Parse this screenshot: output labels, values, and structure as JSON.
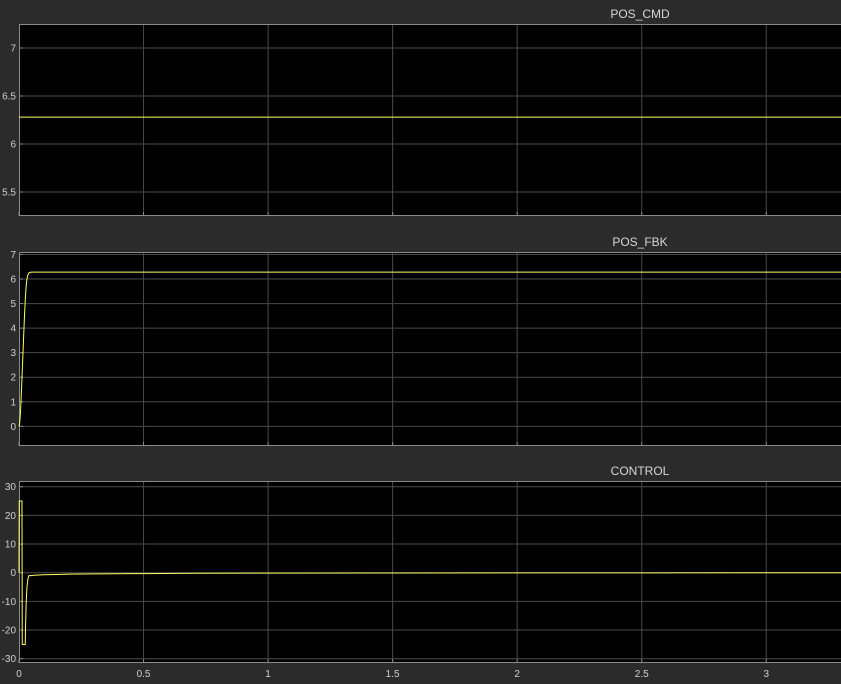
{
  "colors": {
    "figure_bg": "#2b2b2b",
    "axes_bg": "#000000",
    "grid": "#4a4a4a",
    "axes_edge": "#8a8a8a",
    "tick_text": "#cfcfcf",
    "title_text": "#d6d6d6",
    "signal": "#ffff66"
  },
  "chart_data": [
    {
      "type": "line",
      "title": "POS_CMD",
      "xlabel": "",
      "ylabel": "",
      "xlim": [
        0,
        3.3
      ],
      "ylim": [
        5.25,
        7.25
      ],
      "grid": true,
      "x_ticks": [
        0,
        0.5,
        1,
        1.5,
        2,
        2.5,
        3
      ],
      "x_tick_labels": [
        "",
        "",
        "",
        "",
        "",
        "",
        ""
      ],
      "y_ticks": [
        5.5,
        6,
        6.5,
        7
      ],
      "y_tick_labels": [
        "5.5",
        "6",
        "6.5",
        "7"
      ],
      "series": [
        {
          "x": [
            0,
            3.3
          ],
          "y": [
            6.28,
            6.28
          ]
        }
      ]
    },
    {
      "type": "line",
      "title": "POS_FBK",
      "xlabel": "",
      "ylabel": "",
      "xlim": [
        0,
        3.3
      ],
      "ylim": [
        -0.8,
        7.1
      ],
      "grid": true,
      "x_ticks": [
        0,
        0.5,
        1,
        1.5,
        2,
        2.5,
        3
      ],
      "x_tick_labels": [
        "",
        "",
        "",
        "",
        "",
        "",
        ""
      ],
      "y_ticks": [
        0,
        1,
        2,
        3,
        4,
        5,
        6,
        7
      ],
      "y_tick_labels": [
        "0",
        "1",
        "2",
        "3",
        "4",
        "5",
        "6",
        "7"
      ],
      "series": [
        {
          "x": [
            0,
            0.002,
            0.004,
            0.006,
            0.008,
            0.01,
            0.012,
            0.014,
            0.016,
            0.018,
            0.02,
            0.022,
            0.024,
            0.026,
            0.028,
            0.03,
            0.032,
            0.034,
            0.036,
            0.038,
            0.04,
            0.045,
            0.05,
            0.06,
            0.08,
            3.3
          ],
          "y": [
            0,
            0.1,
            0.3,
            0.6,
            1.0,
            1.5,
            2.0,
            2.5,
            3.0,
            3.5,
            4.0,
            4.5,
            4.9,
            5.3,
            5.6,
            5.85,
            6.0,
            6.1,
            6.17,
            6.22,
            6.25,
            6.27,
            6.28,
            6.28,
            6.28,
            6.28
          ]
        }
      ]
    },
    {
      "type": "line",
      "title": "CONTROL",
      "xlabel": "",
      "ylabel": "",
      "xlim": [
        0,
        3.3
      ],
      "ylim": [
        -31.5,
        32
      ],
      "grid": true,
      "x_ticks": [
        0,
        0.5,
        1,
        1.5,
        2,
        2.5,
        3
      ],
      "x_tick_labels": [
        "0",
        "0.5",
        "1",
        "1.5",
        "2",
        "2.5",
        "3"
      ],
      "y_ticks": [
        -30,
        -20,
        -10,
        0,
        10,
        20,
        30
      ],
      "y_tick_labels": [
        "-30",
        "-20",
        "-10",
        "0",
        "10",
        "20",
        "30"
      ],
      "series": [
        {
          "x": [
            0,
            0.001,
            0.012,
            0.013,
            0.025,
            0.026,
            0.029,
            0.032,
            0.036,
            0.04,
            0.045,
            0.05,
            0.06,
            0.08,
            0.1,
            0.15,
            0.2,
            0.3,
            0.4,
            0.5,
            0.7,
            1.0,
            1.5,
            2.0,
            2.5,
            3.0,
            3.3
          ],
          "y": [
            0,
            25,
            25,
            -25,
            -25,
            -20,
            -10,
            -5,
            -2,
            -1,
            -1,
            -1,
            -0.9,
            -0.8,
            -0.7,
            -0.6,
            -0.5,
            -0.4,
            -0.35,
            -0.3,
            -0.2,
            -0.15,
            -0.1,
            -0.05,
            -0.05,
            -0.03,
            -0.02
          ]
        }
      ]
    }
  ]
}
